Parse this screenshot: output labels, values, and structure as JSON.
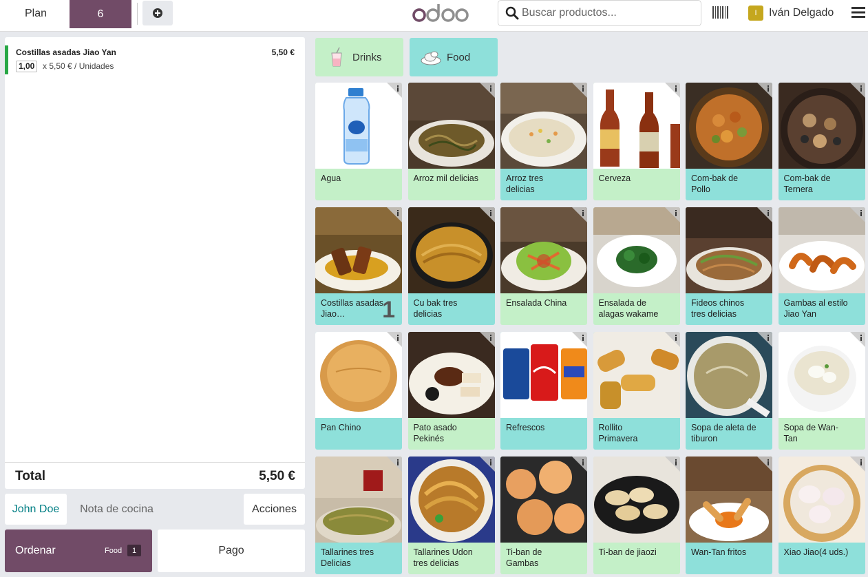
{
  "topbar": {
    "plan_label": "Plan",
    "order_tab": "6",
    "add_icon": "plus-circle-icon",
    "logo_text": "odoo",
    "search_placeholder": "Buscar productos...",
    "barcode_icon": "barcode-icon",
    "user_initial": "I",
    "user_name": "Iván Delgado",
    "menu_icon": "hamburger-menu-icon"
  },
  "order": {
    "lines": [
      {
        "name": "Costillas asadas Jiao Yan",
        "price": "5,50 €",
        "qty": "1,00",
        "detail": "x 5,50 € / Unidades"
      }
    ],
    "total_label": "Total",
    "total_value": "5,50 €"
  },
  "controls": {
    "customer": "John Doe",
    "note": "Nota de cocina",
    "actions": "Acciones",
    "order_label": "Ordenar",
    "order_category": "Food",
    "order_count": "1",
    "pay": "Pago"
  },
  "categories": [
    {
      "label": "Drinks",
      "icon": "drink-cup-icon"
    },
    {
      "label": "Food",
      "icon": "food-plate-icon"
    }
  ],
  "products": [
    {
      "name": "Agua",
      "color": "green",
      "image": "water-bottle"
    },
    {
      "name": "Arroz mil delicias",
      "color": "green",
      "image": "noodle-dish"
    },
    {
      "name": "Arroz tres delicias",
      "color": "teal",
      "image": "rice-dish"
    },
    {
      "name": "Cerveza",
      "color": "green",
      "image": "beer-bottles"
    },
    {
      "name": "Com-bak de Pollo",
      "color": "teal",
      "image": "chicken-dish"
    },
    {
      "name": "Com-bak de Ternera",
      "color": "teal",
      "image": "beef-dish"
    },
    {
      "name": "Costillas asadas Jiao…",
      "color": "teal",
      "image": "ribs-dish",
      "qty": "1"
    },
    {
      "name": "Cu bak tres delicias",
      "color": "teal",
      "image": "crispy-dish"
    },
    {
      "name": "Ensalada China",
      "color": "green",
      "image": "salad-dish"
    },
    {
      "name": "Ensalada de alagas wakame",
      "color": "green",
      "image": "wakame-dish"
    },
    {
      "name": "Fideos chinos tres delicias",
      "color": "teal",
      "image": "fried-noodles"
    },
    {
      "name": "Gambas al estilo Jiao Yan",
      "color": "teal",
      "image": "shrimp-dish"
    },
    {
      "name": "Pan Chino",
      "color": "teal",
      "image": "bread"
    },
    {
      "name": "Pato asado Pekinés",
      "color": "green",
      "image": "duck-dish"
    },
    {
      "name": "Refrescos",
      "color": "teal",
      "image": "soda-cans"
    },
    {
      "name": "Rollito Primavera",
      "color": "teal",
      "image": "spring-rolls"
    },
    {
      "name": "Sopa de aleta de tiburon",
      "color": "teal",
      "image": "soup-bowl"
    },
    {
      "name": "Sopa de Wan-Tan",
      "color": "green",
      "image": "wonton-soup"
    },
    {
      "name": "Tallarines tres Delicias",
      "color": "teal",
      "image": "thin-noodles"
    },
    {
      "name": "Tallarines Udon tres delicias",
      "color": "green",
      "image": "udon-dish"
    },
    {
      "name": "Ti-ban de Gambas",
      "color": "green",
      "image": "fried-shrimp"
    },
    {
      "name": "Ti-ban de jiaozi",
      "color": "green",
      "image": "dumplings"
    },
    {
      "name": "Wan-Tan fritos",
      "color": "teal",
      "image": "fried-wonton"
    },
    {
      "name": "Xiao Jiao(4 uds.)",
      "color": "teal",
      "image": "steamed-dumplings"
    }
  ],
  "colors": {
    "brand": "#714b67",
    "green_category": "#c4f0c8",
    "teal_category": "#8ee0da",
    "customer_link": "#017e84",
    "orderline_accent": "#28a745"
  }
}
